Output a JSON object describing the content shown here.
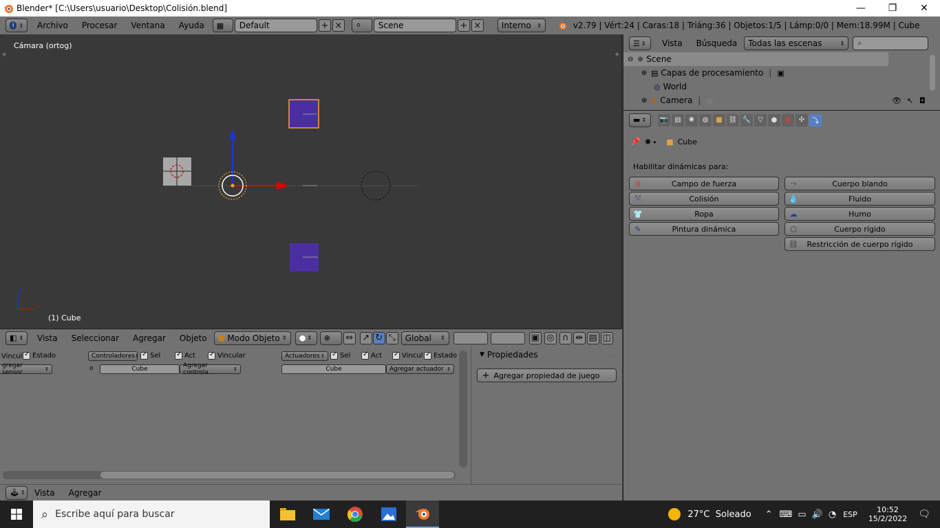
{
  "window": {
    "title": "Blender* [C:\\Users\\usuario\\Desktop\\Colisión.blend]",
    "minimize": "—",
    "maximize": "❐",
    "close": "✕"
  },
  "info_header": {
    "menus": [
      "Archivo",
      "Procesar",
      "Ventana",
      "Ayuda"
    ],
    "screen_layout": "Default",
    "scene": "Scene",
    "render_engine": "Interno",
    "stats": "v2.79 | Vért:24 | Caras:18 | Triáng:36 | Objetos:1/5 | Lámp:0/0 | Mem:18.99M | Cube"
  },
  "viewport": {
    "view_label": "Cámara (ortog)",
    "object_label": "(1) Cube",
    "axis_z": "Z",
    "axis_x": "X",
    "header": {
      "menus": [
        "Vista",
        "Seleccionar",
        "Agregar",
        "Objeto"
      ],
      "mode": "Modo Objeto",
      "orientation": "Global"
    }
  },
  "logic_editor": {
    "sensors": {
      "vincul": "Vincul",
      "estado": "Estado",
      "add": "gregar sensor"
    },
    "controllers": {
      "label": "Controladores",
      "sel": "Sel",
      "act": "Act",
      "vincular": "Vincular",
      "object": "Cube",
      "add": "Agregar controla..."
    },
    "actuators": {
      "label": "Actuadores",
      "sel": "Sel",
      "act": "Act",
      "vincul": "Vincul",
      "estado": "Estado",
      "object": "Cube",
      "add": "Agregar actuador"
    },
    "properties": {
      "title": "Propiedades",
      "add_button": "Agregar propiedad de juego"
    },
    "footer_menus": [
      "Vista",
      "Agregar"
    ]
  },
  "outliner": {
    "menus": [
      "Vista",
      "Búsqueda"
    ],
    "filter": "Todas las escenas",
    "items": [
      {
        "label": "Scene"
      },
      {
        "label": "Capas de procesamiento"
      },
      {
        "label": "World"
      },
      {
        "label": "Camera"
      }
    ]
  },
  "properties": {
    "breadcrumb_object": "Cube",
    "section_label": "Habilitar dinámicas para:",
    "buttons_left": [
      "Campo de fuerza",
      "Colisión",
      "Ropa",
      "Pintura dinámica"
    ],
    "buttons_right": [
      "Cuerpo blando",
      "Fluido",
      "Humo",
      "Cuerpo rígido",
      "Restricción de cuerpo rígido"
    ]
  },
  "taskbar": {
    "search_placeholder": "Escribe aquí para buscar",
    "weather": "27°C  Soleado",
    "lang": "ESP",
    "time": "10:52",
    "date": "15/2/2022"
  },
  "colors": {
    "accent_orange": "#f5a623",
    "cube_purple": "#4a2fa3",
    "axis_red": "#e00000",
    "axis_blue": "#1a37d6",
    "active_tab_blue": "#5680c2"
  }
}
